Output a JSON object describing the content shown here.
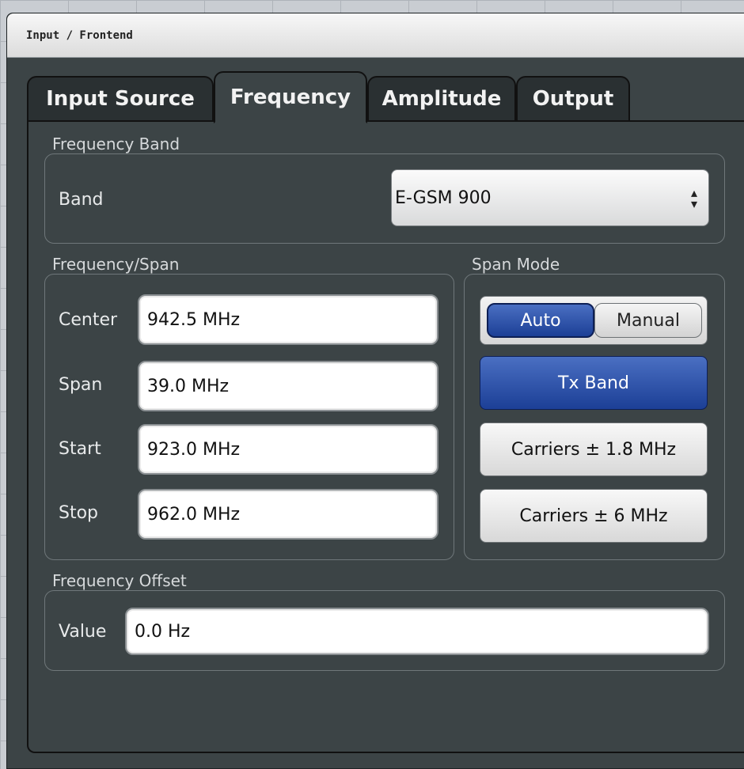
{
  "dialog": {
    "title": "Input / Frontend"
  },
  "tabs": [
    {
      "label": "Input Source",
      "active": false
    },
    {
      "label": "Frequency",
      "active": true
    },
    {
      "label": "Amplitude",
      "active": false
    },
    {
      "label": "Output",
      "active": false
    }
  ],
  "frequency_band": {
    "section_label": "Frequency Band",
    "band_label": "Band",
    "band_value": "E-GSM 900"
  },
  "frequency_span": {
    "section_label": "Frequency/Span",
    "center_label": "Center",
    "center_value": "942.5 MHz",
    "span_label": "Span",
    "span_value": "39.0 MHz",
    "start_label": "Start",
    "start_value": "923.0 MHz",
    "stop_label": "Stop",
    "stop_value": "962.0 MHz"
  },
  "span_mode": {
    "section_label": "Span Mode",
    "auto_label": "Auto",
    "manual_label": "Manual",
    "selected": "Auto",
    "tx_band_label": "Tx Band",
    "carriers_1_8_label": "Carriers ± 1.8 MHz",
    "carriers_6_label": "Carriers ± 6 MHz"
  },
  "frequency_offset": {
    "section_label": "Frequency Offset",
    "value_label": "Value",
    "value": "0.0 Hz"
  },
  "colors": {
    "dialog_bg": "#3c4446",
    "accent_blue": "#1c3f96"
  },
  "icons": {
    "dropdown_arrow": "updown-arrow-icon"
  }
}
